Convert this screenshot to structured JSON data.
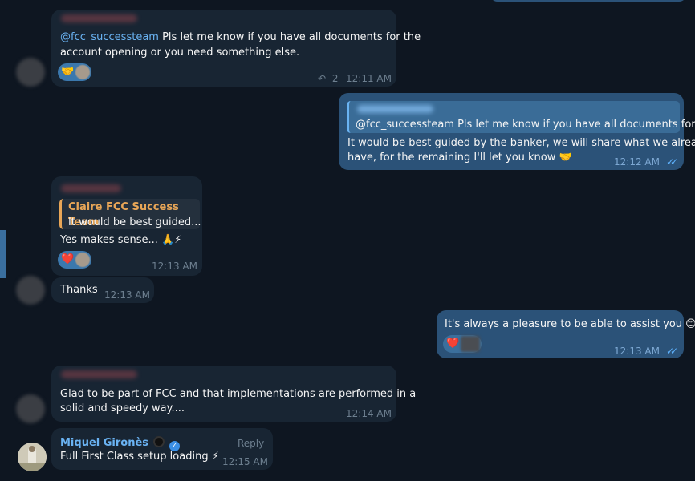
{
  "messages": {
    "m1": {
      "mention": "@fcc_successteam",
      "line1_rest": " Pls let me know if you have all documents for the",
      "line2": "account opening or you need something else.",
      "reaction_emoji": "🤝",
      "replies": "2",
      "time": "12:11 AM"
    },
    "m2": {
      "quote_text": "@fcc_successteam Pls let me know if you have all documents for...",
      "line1": "It would be best guided by the banker, we will share what we already",
      "line2": "have, for the remaining I'll let you know 🤝",
      "time": "12:12 AM",
      "status": "✓✓"
    },
    "m3": {
      "quote_name": "Claire FCC Success Team",
      "quote_text": "It would be best guided...",
      "text": "Yes makes sense... 🙏⚡",
      "reaction_emoji": "❤️",
      "time": "12:13 AM"
    },
    "m4": {
      "text": "Thanks",
      "time": "12:13 AM"
    },
    "m5": {
      "text": "It's always a pleasure to be able to assist you 😊",
      "reaction_emoji": "❤️",
      "time": "12:13 AM",
      "status": "✓✓"
    },
    "m6": {
      "line1": "Glad to be part of FCC and that implementations are performed in a",
      "line2": "solid and speedy way....",
      "time": "12:14 AM"
    },
    "m7": {
      "sender": "Miquel Gironès",
      "reply_label": "Reply",
      "text": "Full First Class setup loading ⚡",
      "time": "12:15 AM"
    }
  }
}
